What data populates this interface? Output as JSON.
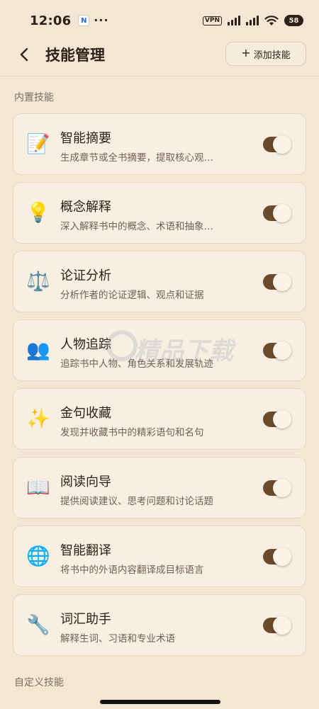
{
  "status_bar": {
    "time": "12:06",
    "notification_glyph": "N",
    "more": "···",
    "vpn": "VPN",
    "battery": "58"
  },
  "header": {
    "title": "技能管理",
    "add_label": "添加技能",
    "add_glyph": "+"
  },
  "sections": {
    "builtin": "内置技能",
    "custom": "自定义技能"
  },
  "skills": [
    {
      "icon": "📝",
      "icon_name": "memo-icon",
      "name": "智能摘要",
      "desc": "生成章节或全书摘要，提取核心观…",
      "enabled": true
    },
    {
      "icon": "💡",
      "icon_name": "lightbulb-icon",
      "name": "概念解释",
      "desc": "深入解释书中的概念、术语和抽象…",
      "enabled": true
    },
    {
      "icon": "⚖️",
      "icon_name": "scales-icon",
      "name": "论证分析",
      "desc": "分析作者的论证逻辑、观点和证据",
      "enabled": true
    },
    {
      "icon": "👥",
      "icon_name": "people-icon",
      "name": "人物追踪",
      "desc": "追踪书中人物、角色关系和发展轨迹",
      "enabled": true
    },
    {
      "icon": "✨",
      "icon_name": "sparkles-icon",
      "name": "金句收藏",
      "desc": "发现并收藏书中的精彩语句和名句",
      "enabled": true
    },
    {
      "icon": "📖",
      "icon_name": "open-book-icon",
      "name": "阅读向导",
      "desc": "提供阅读建议、思考问题和讨论话题",
      "enabled": true
    },
    {
      "icon": "🌐",
      "icon_name": "globe-icon",
      "name": "智能翻译",
      "desc": "将书中的外语内容翻译成目标语言",
      "enabled": true
    },
    {
      "icon": "🔧",
      "icon_name": "wrench-icon",
      "name": "词汇助手",
      "desc": "解释生词、习语和专业术语",
      "enabled": true
    }
  ],
  "watermark": {
    "main": "精品下载",
    "sub": "jpxz.com"
  },
  "colors": {
    "background": "#f3e7d3",
    "card": "#f8efe2",
    "toggle_on": "#6b4a2b"
  }
}
